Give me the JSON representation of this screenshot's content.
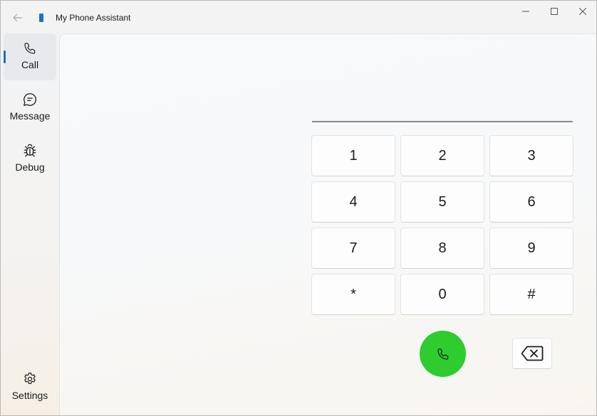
{
  "window": {
    "title": "My Phone Assistant"
  },
  "sidebar": {
    "items": [
      {
        "label": "Call",
        "icon": "phone-icon",
        "selected": true
      },
      {
        "label": "Message",
        "icon": "message-icon",
        "selected": false
      },
      {
        "label": "Debug",
        "icon": "bug-icon",
        "selected": false
      }
    ],
    "footer": {
      "label": "Settings",
      "icon": "gear-icon"
    }
  },
  "dialer": {
    "number_value": "",
    "keys": [
      "1",
      "2",
      "3",
      "4",
      "5",
      "6",
      "7",
      "8",
      "9",
      "*",
      "0",
      "#"
    ]
  },
  "colors": {
    "accent": "#1a6fc0",
    "call_button": "#2ecc2e"
  }
}
